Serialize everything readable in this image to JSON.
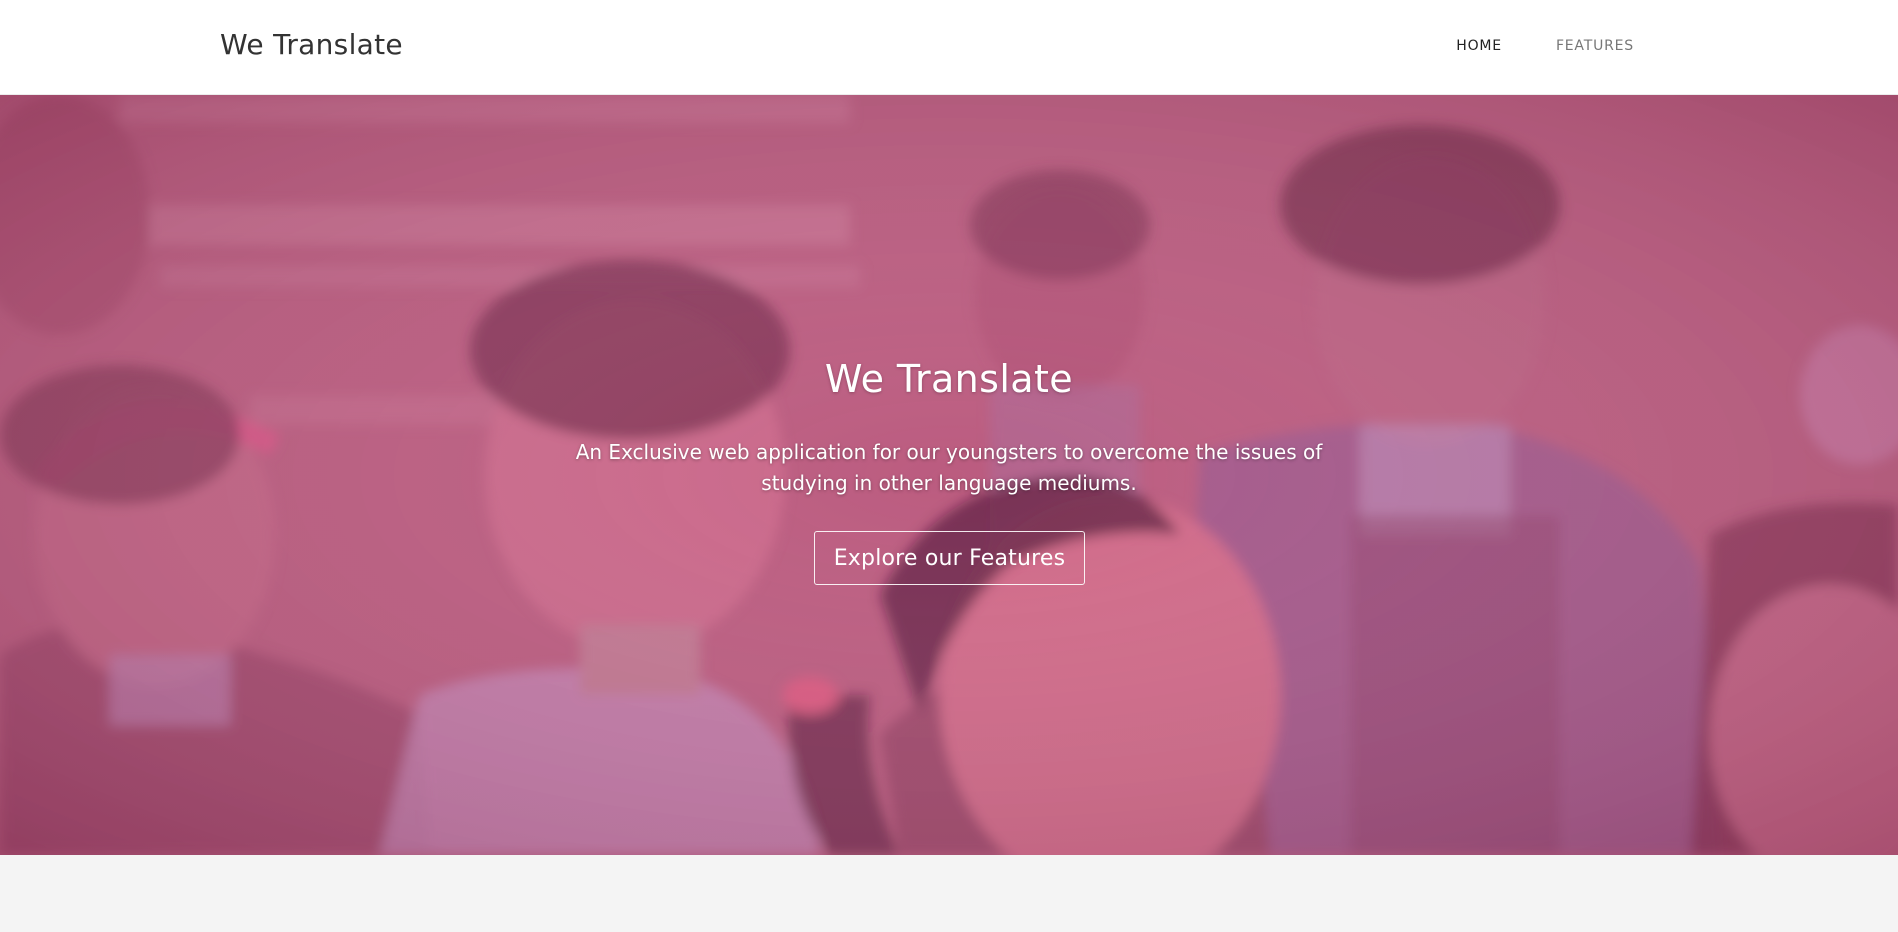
{
  "navbar": {
    "brand": "We Translate",
    "links": [
      {
        "label": "HOME",
        "active": true
      },
      {
        "label": "FEATURES",
        "active": false
      }
    ]
  },
  "hero": {
    "title": "We Translate",
    "subtitle": "An Exclusive web application for our youngsters to overcome the issues of studying in other language mediums.",
    "cta_label": "Explore our Features",
    "overlay_color": "#c2577f",
    "background_image": "photo-of-schoolchildren-looking-up"
  },
  "colors": {
    "nav_bg": "#ffffff",
    "brand_text": "#333333",
    "nav_active": "#222222",
    "nav_inactive": "#777777",
    "page_bg": "#f4f4f4"
  }
}
